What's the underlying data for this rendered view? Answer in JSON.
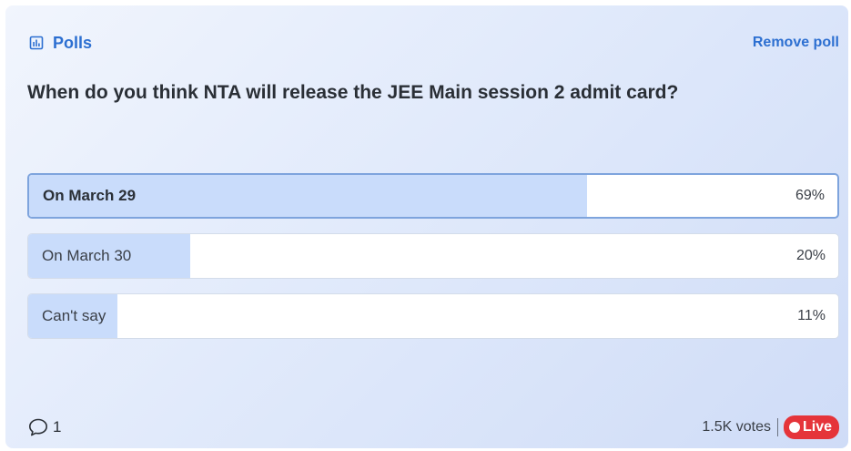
{
  "header": {
    "title": "Polls",
    "title_icon": "bar-chart-icon",
    "remove_label": "Remove poll"
  },
  "question": "When do you think NTA will release the JEE Main session 2 admit card?",
  "options": [
    {
      "label": "On March 29",
      "percent_label": "69%",
      "percent": 69,
      "selected": true
    },
    {
      "label": "On March 30",
      "percent_label": "20%",
      "percent": 20,
      "selected": false
    },
    {
      "label": "Can't say",
      "percent_label": "11%",
      "percent": 11,
      "selected": false
    }
  ],
  "footer": {
    "comment_icon": "comment-bubble-icon",
    "comment_count": "1",
    "votes_label": "1.5K votes",
    "live_label": "Live"
  },
  "colors": {
    "accent": "#2c6fd1",
    "bar_fill": "#c9dcfb",
    "live_badge": "#e5343a"
  }
}
